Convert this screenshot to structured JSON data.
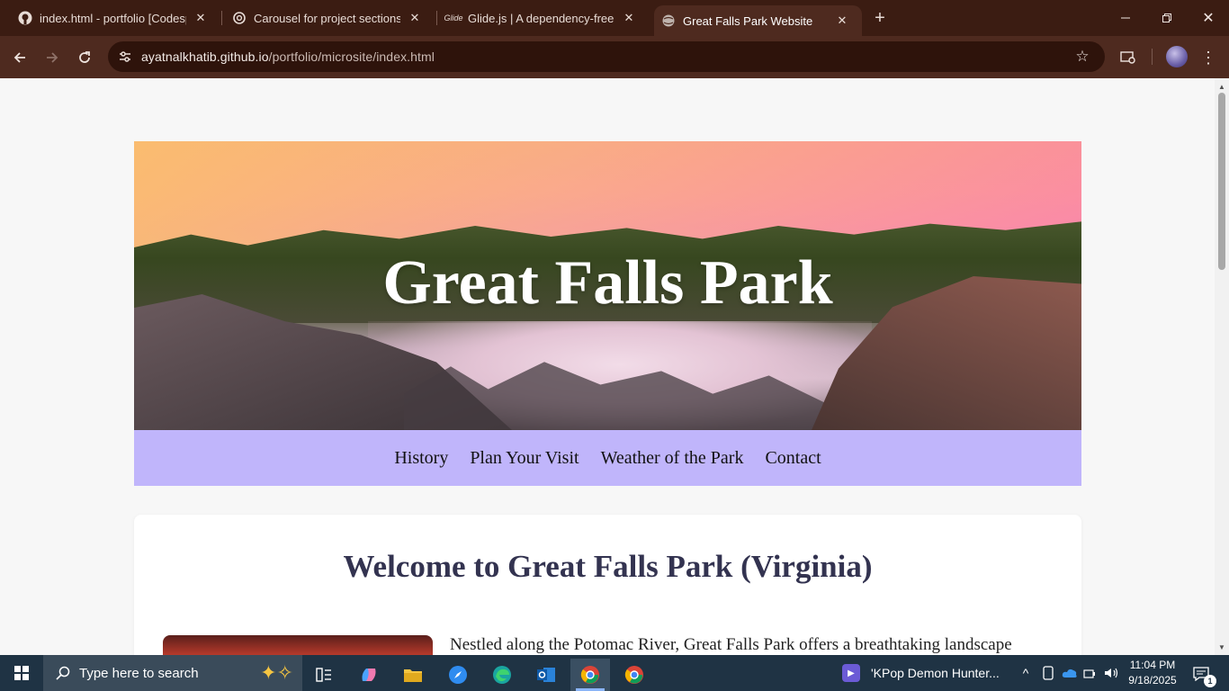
{
  "browser": {
    "tabs": [
      {
        "title": "index.html - portfolio [Codespa",
        "icon": "github-icon",
        "active": false
      },
      {
        "title": "Carousel for project sections",
        "icon": "openai-icon",
        "active": false
      },
      {
        "title": "Glide.js | A dependency-free Jav",
        "icon": "glide-icon",
        "active": false
      },
      {
        "title": "Great Falls Park Website",
        "icon": "globe-icon",
        "active": true
      }
    ],
    "address": {
      "host": "ayatnalkhatib.github.io",
      "path": "/portfolio/microsite/index.html"
    }
  },
  "page": {
    "hero_title": "Great Falls Park",
    "nav": [
      "History",
      "Plan Your Visit",
      "Weather of the Park",
      "Contact"
    ],
    "welcome_heading": "Welcome to Great Falls Park (Virginia)",
    "intro_text": "Nestled along the Potomac River, Great Falls Park offers a breathtaking landscape"
  },
  "taskbar": {
    "search_placeholder": "Type here to search",
    "media_title": "'KPop Demon Hunter...",
    "time": "11:04 PM",
    "date": "9/18/2025",
    "notification_count": "1"
  },
  "colors": {
    "tabbar": "#3b1c12",
    "toolbar": "#4e2a1f",
    "nav_background": "#c0b5fb",
    "heading": "#333350",
    "taskbar": "#1f3344"
  }
}
